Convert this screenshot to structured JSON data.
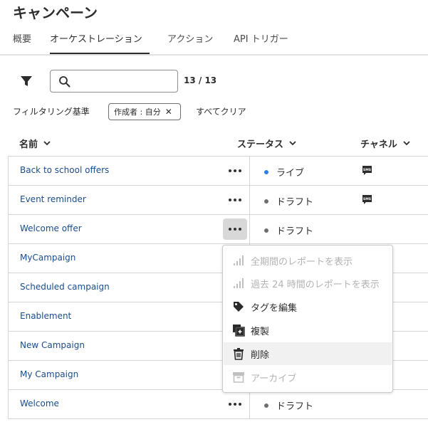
{
  "page": {
    "title": "キャンペーン"
  },
  "tabs": [
    {
      "label": "概要"
    },
    {
      "label": "オーケストレーション"
    },
    {
      "label": "アクション"
    },
    {
      "label": "API トリガー"
    }
  ],
  "toolbar": {
    "search_placeholder": "",
    "search_value": "",
    "count": "13 / 13",
    "filter_label": "フィルタリング基準",
    "filter_chip": "作成者 : 自分",
    "clear_all": "すべてクリア"
  },
  "columns": {
    "name": "名前",
    "status": "ステータス",
    "channel": "チャネル"
  },
  "rows": [
    {
      "name": "Back to school offers",
      "status": "ライブ",
      "status_color": "#2680eb",
      "channel": "SMS",
      "channel_icon": "sms-icon"
    },
    {
      "name": "Event reminder",
      "status": "ドラフト",
      "status_color": "#6e6e6e",
      "channel": "SMS",
      "channel_icon": "sms-icon"
    },
    {
      "name": "Welcome offer",
      "status": "ドラフト",
      "status_color": "#6e6e6e",
      "channel": ""
    },
    {
      "name": "MyCampaign"
    },
    {
      "name": "Scheduled campaign"
    },
    {
      "name": "Enablement"
    },
    {
      "name": "New Campaign"
    },
    {
      "name": "My Campaign"
    },
    {
      "name": "Welcome",
      "status": "ドラフト",
      "status_color": "#6e6e6e",
      "channel": ""
    }
  ],
  "context_menu": {
    "items": [
      {
        "label": "全期間のレポートを表示",
        "icon": "chart-icon",
        "disabled": true
      },
      {
        "label": "過去 24 時間のレポートを表示",
        "icon": "chart-icon",
        "disabled": true
      },
      {
        "label": "タグを編集",
        "icon": "tag-icon",
        "disabled": false
      },
      {
        "label": "複製",
        "icon": "duplicate-icon",
        "disabled": false
      },
      {
        "label": "削除",
        "icon": "delete-icon",
        "disabled": false,
        "hovered": true
      },
      {
        "label": "アーカイブ",
        "icon": "archive-icon",
        "disabled": true
      }
    ]
  },
  "colors": {
    "link": "#1a4c8c",
    "live": "#2680eb",
    "draft": "#6e6e6e"
  }
}
